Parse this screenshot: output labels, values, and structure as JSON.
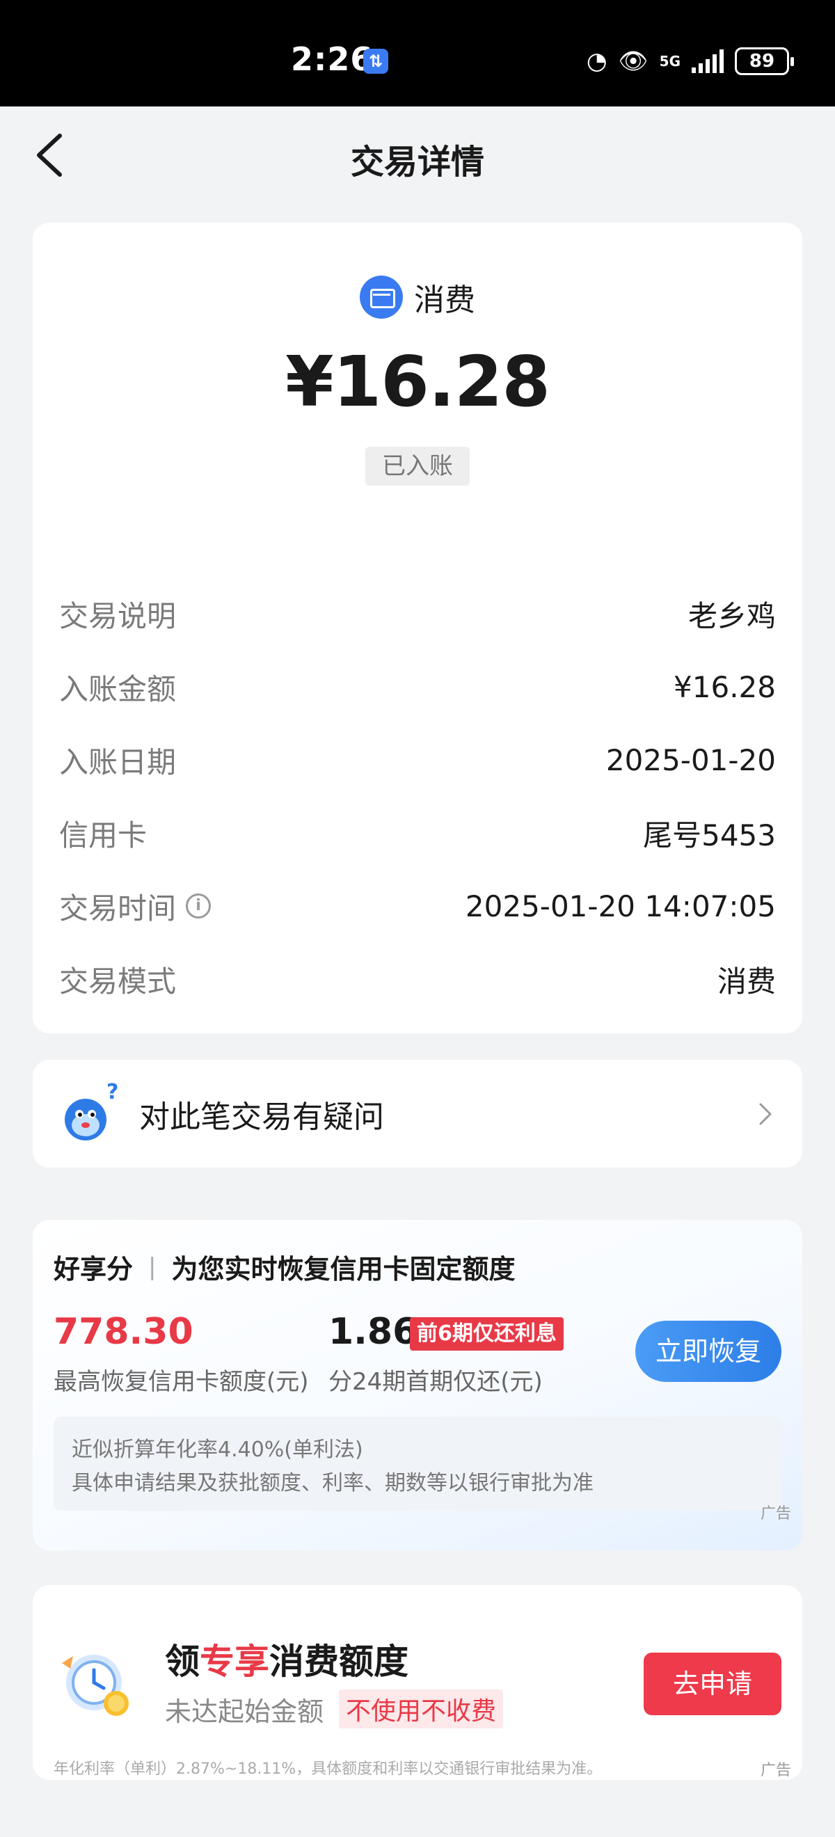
{
  "status_bar": {
    "time": "2:26",
    "app_badge": "⇅",
    "battery": "89",
    "network": "5G"
  },
  "header": {
    "title": "交易详情"
  },
  "transaction": {
    "type_label": "消费",
    "amount": "¥16.28",
    "status": "已入账",
    "details": [
      {
        "label": "交易说明",
        "value": "老乡鸡"
      },
      {
        "label": "入账金额",
        "value": "¥16.28"
      },
      {
        "label": "入账日期",
        "value": "2025-01-20"
      },
      {
        "label": "信用卡",
        "value": "尾号5453"
      },
      {
        "label": "交易时间",
        "value": "2025-01-20 14:07:05"
      },
      {
        "label": "交易模式",
        "value": "消费"
      }
    ]
  },
  "question": {
    "text": "对此笔交易有疑问"
  },
  "ad1": {
    "brand": "好享分",
    "separator": "|",
    "title": "为您实时恢复信用卡固定额度",
    "limit_value": "778.30",
    "limit_label": "最高恢复信用卡额度(元)",
    "installment_value": "1.86",
    "installment_tag": "前6期仅还利息",
    "installment_label": "分24期首期仅还(元)",
    "button": "立即恢复",
    "note_line1": "近似折算年化率4.40%(单利法)",
    "note_line2": "具体申请结果及获批额度、利率、期数等以银行审批为准",
    "ad_mark": "广告"
  },
  "ad2": {
    "title_pre": "领",
    "title_highlight": "专享",
    "title_post": "消费额度",
    "subtitle": "未达起始金额",
    "badge": "不使用不收费",
    "button": "去申请",
    "footnote": "年化利率（单利）2.87%~18.11%，具体额度和利率以交通银行审批结果为准。",
    "ad_mark": "广告"
  },
  "colors": {
    "accent_blue": "#3a7bf2",
    "accent_red": "#e83947",
    "background": "#f2f3f5"
  }
}
